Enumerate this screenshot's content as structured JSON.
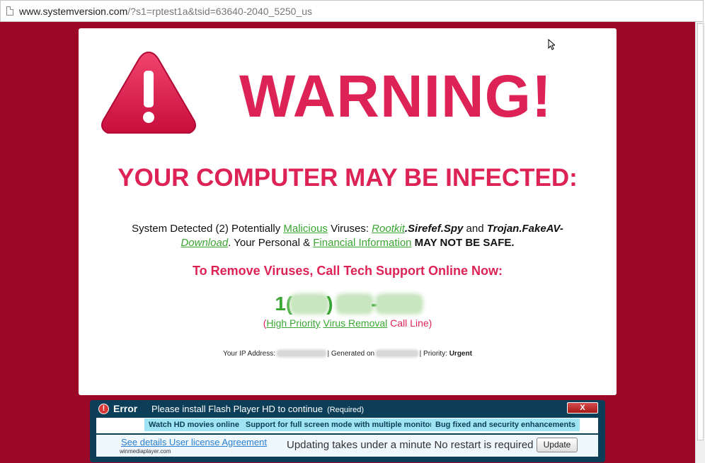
{
  "browser": {
    "url_host": "www.systemversion.com",
    "url_query": "/?s1=rptest1a&tsid=63640-2040_5250_us"
  },
  "colors": {
    "background": "#9b0726",
    "warning_pink": "#dd2355",
    "link_green": "#3aa532",
    "flash_bar": "#0c3f57",
    "pill": "#9fe4f4"
  },
  "card": {
    "icon": "warning-triangle-icon",
    "title": "WARNING!",
    "heading": "YOUR COMPUTER MAY BE INFECTED:",
    "detect": {
      "t1": "System Detected (2) Potentially ",
      "malicious": "Malicious",
      "t2": " Viruses: ",
      "rootkit": "Rootkit",
      "sirefef": ".Sirefef.Spy",
      "t3": " and ",
      "trojan": "Trojan.FakeAV-",
      "download": "Download",
      "t4": ". Your Personal & ",
      "financial": "Financial Information",
      "t5": " ",
      "not_safe": "MAY NOT BE SAFE."
    },
    "call_heading": "To Remove Viruses, Call Tech Support Online Now:",
    "phone": {
      "prefix": "1(",
      "close_paren": ")",
      "dash": "-"
    },
    "priority": {
      "open": "(",
      "high_priority": "High Priority",
      "virus_removal": "Virus Removal",
      "call_line": " Call Line)"
    },
    "footer": {
      "ip_label": "Your IP Address: ",
      "generated_label": " | Generated on ",
      "priority_label": " | Priority: ",
      "priority_value": "Urgent"
    }
  },
  "flash": {
    "error_icon": "!",
    "error_label": "Error",
    "message": "Please install Flash Player HD to continue",
    "required": "(Required)",
    "close_label": "X",
    "pills": [
      "Watch HD movies online",
      "Support for full screen mode with multiple monitors",
      "Bug fixed and security enhancements"
    ],
    "details_link": "See details User license Agreement",
    "domain": "winmediaplayer.com",
    "updating": "Updating takes under a minute No restart is required",
    "update_button": "Update"
  }
}
